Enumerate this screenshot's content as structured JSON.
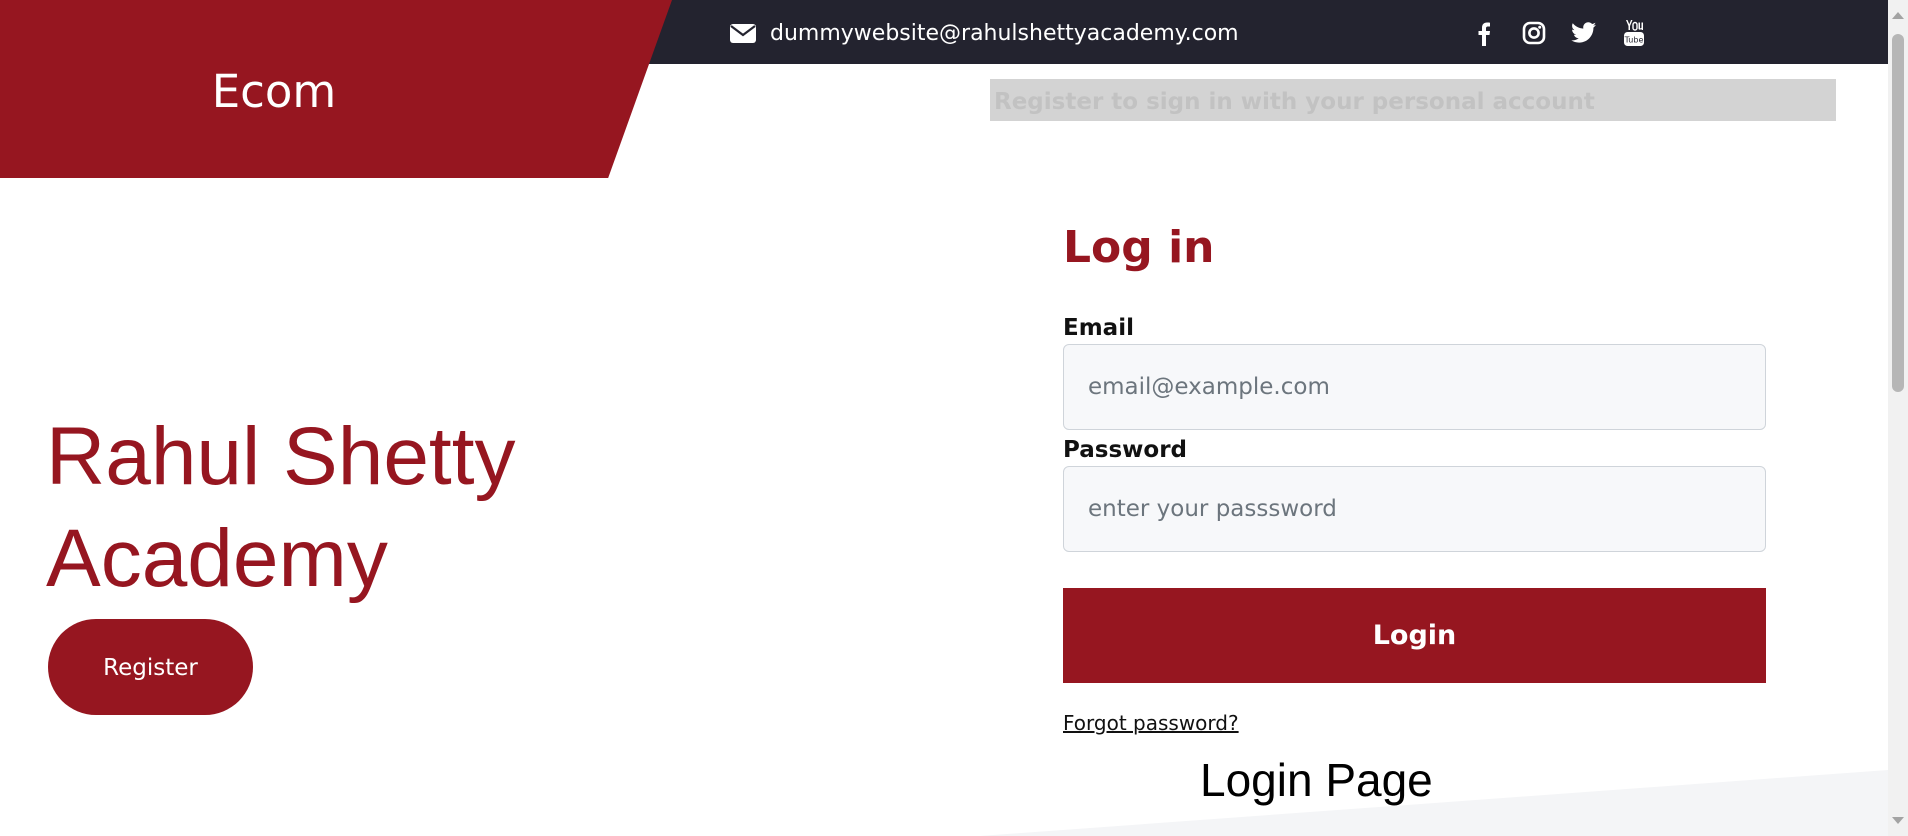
{
  "header": {
    "brand": "Ecom",
    "contact_email": "dummywebsite@rahulshettyacademy.com",
    "contact_icon": "envelope-icon",
    "social_icons": [
      "facebook-icon",
      "instagram-icon",
      "twitter-icon",
      "youtube-icon"
    ],
    "brand_color": "#961620",
    "topbar_color": "#23232f"
  },
  "banner": {
    "text": "Register to sign in with your personal account"
  },
  "hero": {
    "title_line1": "Rahul Shetty",
    "title_line2": "Academy",
    "register_label": "Register"
  },
  "login": {
    "heading": "Log in",
    "email_label": "Email",
    "email_placeholder": "email@example.com",
    "password_label": "Password",
    "password_placeholder": "enter your passsword",
    "button_label": "Login",
    "forgot_label": "Forgot password?"
  },
  "footer": {
    "caption": "Login Page"
  }
}
